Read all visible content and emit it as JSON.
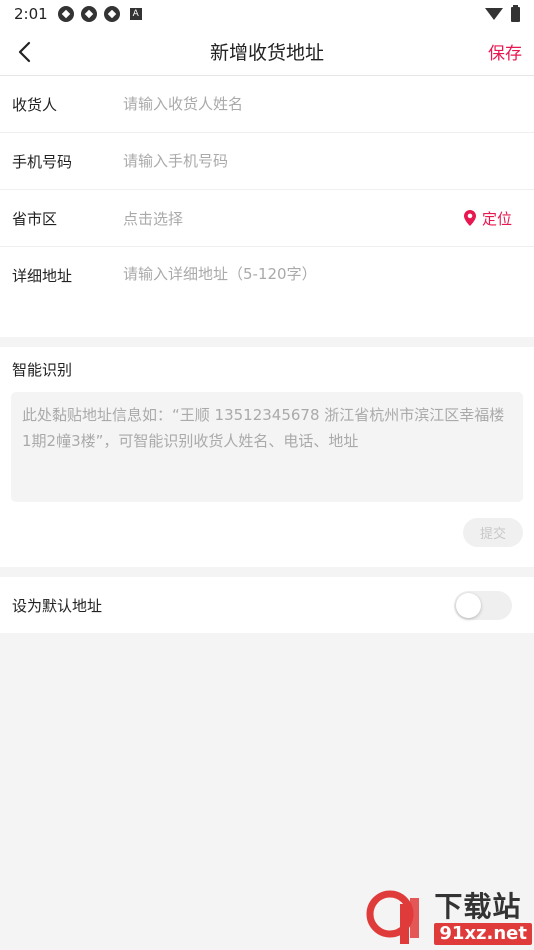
{
  "status_bar": {
    "time": "2:01"
  },
  "header": {
    "title": "新增收货地址",
    "save_label": "保存"
  },
  "form": {
    "name": {
      "label": "收货人",
      "placeholder": "请输入收货人姓名",
      "value": ""
    },
    "phone": {
      "label": "手机号码",
      "placeholder": "请输入手机号码",
      "value": ""
    },
    "region": {
      "label": "省市区",
      "placeholder": "点击选择",
      "locate_label": "定位"
    },
    "detail": {
      "label": "详细地址",
      "placeholder": "请输入详细地址（5-120字）",
      "value": ""
    }
  },
  "smart_recognition": {
    "title": "智能识别",
    "placeholder": "此处黏贴地址信息如：“王顺 13512345678 浙江省杭州市滨江区幸福楼1期2幢3楼”，可智能识别收货人姓名、电话、地址",
    "submit_label": "提交"
  },
  "default_address": {
    "label": "设为默认地址",
    "enabled": false
  },
  "watermark": {
    "big": "下载站",
    "small": "91xz.net"
  },
  "colors": {
    "accent": "#e8174f",
    "background": "#f4f4f4"
  }
}
